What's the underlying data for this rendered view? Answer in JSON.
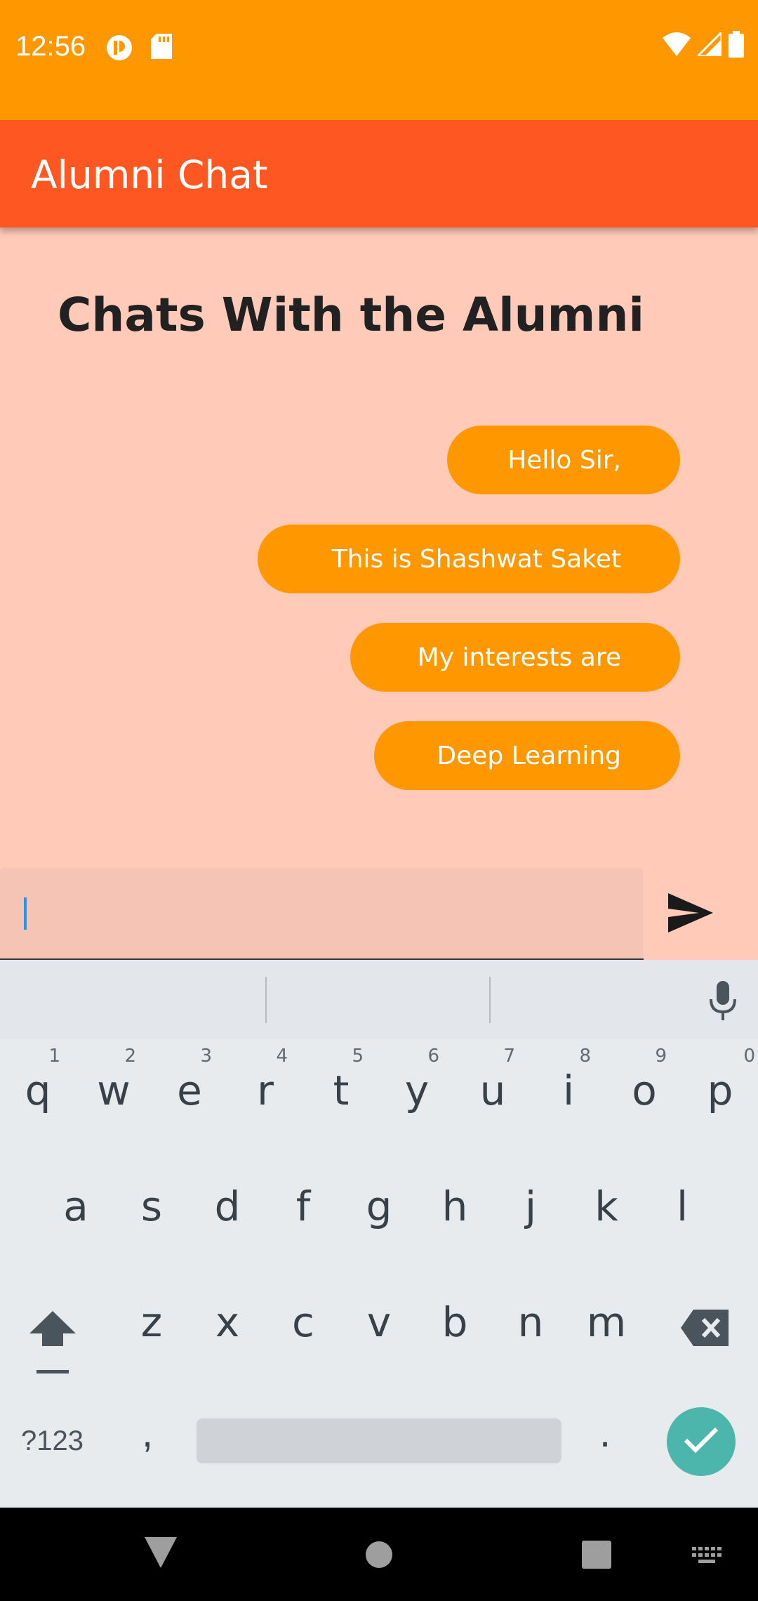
{
  "status_bar": {
    "time": "12:56",
    "left_icons": [
      "notification-app-icon",
      "sd-card-icon"
    ],
    "right_icons": [
      "wifi-icon",
      "signal-icon",
      "battery-icon"
    ]
  },
  "app_bar": {
    "title": "Alumni Chat"
  },
  "page": {
    "heading": "Chats With the Alumni"
  },
  "messages": [
    {
      "text": "Hello Sir,"
    },
    {
      "text": "This is Shashwat Saket"
    },
    {
      "text": "My interests are"
    },
    {
      "text": "Deep Learning"
    }
  ],
  "composer": {
    "value": "",
    "placeholder": "",
    "send_icon": "send-icon"
  },
  "keyboard": {
    "row1": [
      {
        "ch": "q",
        "num": "1"
      },
      {
        "ch": "w",
        "num": "2"
      },
      {
        "ch": "e",
        "num": "3"
      },
      {
        "ch": "r",
        "num": "4"
      },
      {
        "ch": "t",
        "num": "5"
      },
      {
        "ch": "y",
        "num": "6"
      },
      {
        "ch": "u",
        "num": "7"
      },
      {
        "ch": "i",
        "num": "8"
      },
      {
        "ch": "o",
        "num": "9"
      },
      {
        "ch": "p",
        "num": "0"
      }
    ],
    "row2": [
      "a",
      "s",
      "d",
      "f",
      "g",
      "h",
      "j",
      "k",
      "l"
    ],
    "row3": [
      "z",
      "x",
      "c",
      "v",
      "b",
      "n",
      "m"
    ],
    "symbols_label": "?123",
    "comma": ",",
    "period": "."
  },
  "colors": {
    "status_bar": "#ff9800",
    "app_bar": "#ff5722",
    "background": "#ffcab8",
    "bubble": "#ff9800",
    "enter_key": "#4db6ac"
  }
}
